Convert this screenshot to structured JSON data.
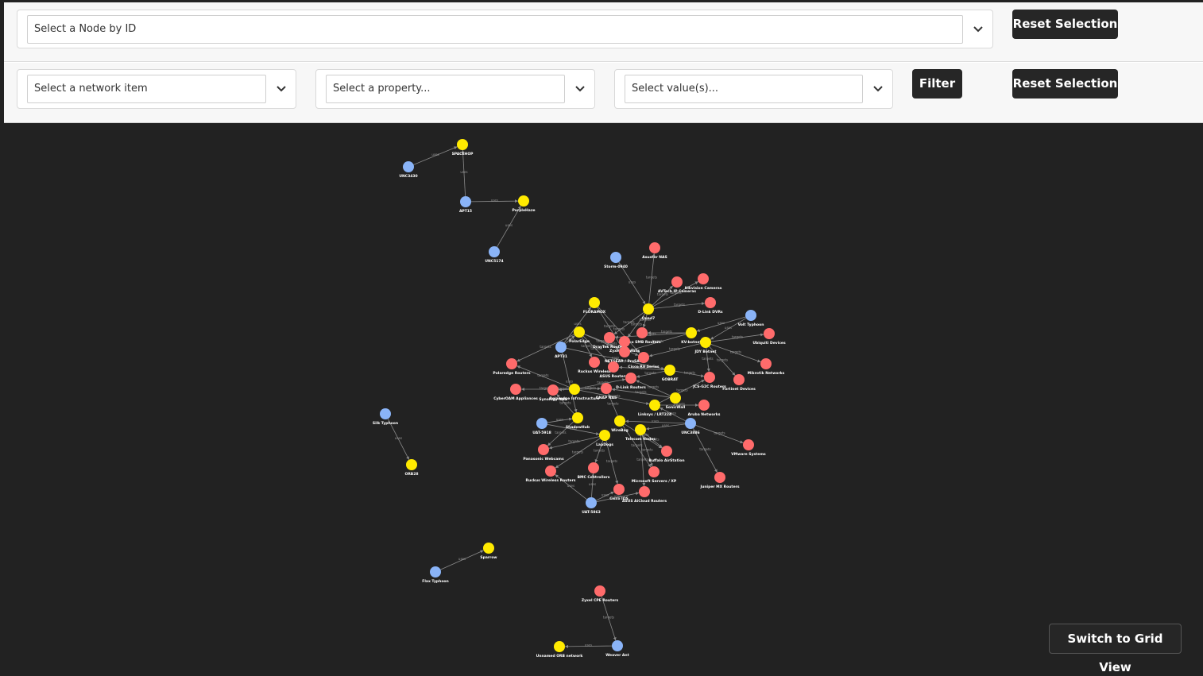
{
  "node_select": {
    "placeholder": "Select a Node by ID",
    "reset_label": "Reset Selection"
  },
  "filter_bar": {
    "network_item_placeholder": "Select a network item",
    "property_placeholder": "Select a property...",
    "value_placeholder": "Select value(s)...",
    "filter_label": "Filter",
    "reset_label": "Reset Selection"
  },
  "graph": {
    "edge_label_targets": "targets",
    "edge_label_uses": "uses",
    "colors": {
      "blue": "#8ab4f8",
      "yellow": "#ffea00",
      "red": "#ff6b6b",
      "background": "#222222",
      "edge": "#8a8a8a",
      "label": "#ffffff"
    },
    "nodes": [
      {
        "id": "unc3430",
        "label": "UNC3430",
        "color": "blue"
      },
      {
        "id": "spacehop",
        "label": "SPACEHOP",
        "color": "yellow"
      },
      {
        "id": "apt15",
        "label": "APT15",
        "color": "blue"
      },
      {
        "id": "purplehaze",
        "label": "PurpleHaze",
        "color": "yellow"
      },
      {
        "id": "unc5174",
        "label": "UNC5174",
        "color": "blue"
      },
      {
        "id": "storm0940",
        "label": "Storm-0940",
        "color": "blue"
      },
      {
        "id": "asustornas",
        "label": "Asustor NAS",
        "color": "red"
      },
      {
        "id": "avtechcam",
        "label": "AVTech IP Cameras",
        "color": "red"
      },
      {
        "id": "hikvision",
        "label": "Hikvision Cameras",
        "color": "red"
      },
      {
        "id": "quad7",
        "label": "Quad7",
        "color": "yellow"
      },
      {
        "id": "floramox",
        "label": "FLORAMOX",
        "color": "yellow"
      },
      {
        "id": "dlinkdvr",
        "label": "D-Link DVRs",
        "color": "red"
      },
      {
        "id": "volttyphoon",
        "label": "Volt Typhoon",
        "color": "blue"
      },
      {
        "id": "ubiquiti",
        "label": "Ubiquiti Devices",
        "color": "red"
      },
      {
        "id": "mikrotik",
        "label": "Mikrotik Networks",
        "color": "red"
      },
      {
        "id": "kvbotnet",
        "label": "KV-botnet",
        "color": "yellow"
      },
      {
        "id": "jdysched",
        "label": "JDY Botnet",
        "color": "yellow"
      },
      {
        "id": "fortinet",
        "label": "Fortinet Devices",
        "color": "red"
      },
      {
        "id": "ciscosmb",
        "label": "Cisco SMB Routers",
        "color": "red"
      },
      {
        "id": "draytek",
        "label": "DrayTek Routers",
        "color": "red"
      },
      {
        "id": "polardsn",
        "label": "PolarEdge",
        "color": "yellow"
      },
      {
        "id": "zyxel",
        "label": "Zyxel Firewalls",
        "color": "red"
      },
      {
        "id": "apt31",
        "label": "APT31",
        "color": "blue"
      },
      {
        "id": "netgear",
        "label": "NETGEAR / ProSAFE",
        "color": "red"
      },
      {
        "id": "ciscorv",
        "label": "Cisco RV Series",
        "color": "red"
      },
      {
        "id": "ruckus",
        "label": "Ruckus Wireless",
        "color": "red"
      },
      {
        "id": "asusrouters",
        "label": "ASUS Routers",
        "color": "red"
      },
      {
        "id": "polaredgerouters",
        "label": "Polaredge Routers",
        "color": "red"
      },
      {
        "id": "gobrat",
        "label": "GOBRAT",
        "color": "yellow"
      },
      {
        "id": "jcsrouters",
        "label": "JCS-G2C Routers",
        "color": "red"
      },
      {
        "id": "dlinkrouters",
        "label": "D-Link Routers",
        "color": "red"
      },
      {
        "id": "cyberoam",
        "label": "CyberOAM Appliances",
        "color": "red"
      },
      {
        "id": "synology",
        "label": "Synology NAS",
        "color": "red"
      },
      {
        "id": "polinfra",
        "label": "Polaredge Infrastructure",
        "color": "yellow"
      },
      {
        "id": "qnapnas",
        "label": "QNAP NAS",
        "color": "red"
      },
      {
        "id": "linksys",
        "label": "Linksys / LRT224",
        "color": "yellow"
      },
      {
        "id": "arubanet",
        "label": "Aruba Networks",
        "color": "red"
      },
      {
        "id": "sonicwall",
        "label": "SonicWall",
        "color": "yellow"
      },
      {
        "id": "uat5918",
        "label": "UAT-5918",
        "color": "blue"
      },
      {
        "id": "shadowhub",
        "label": "ShadowHub",
        "color": "yellow"
      },
      {
        "id": "unc3886",
        "label": "UNC3886",
        "color": "blue"
      },
      {
        "id": "wirebag",
        "label": "WireBag",
        "color": "yellow"
      },
      {
        "id": "lapdogs",
        "label": "LapDogs",
        "color": "yellow"
      },
      {
        "id": "topolnodes",
        "label": "Telecom Nodes",
        "color": "yellow"
      },
      {
        "id": "vmware",
        "label": "VMware Systems",
        "color": "red"
      },
      {
        "id": "panasonic",
        "label": "Panasonic Webcams",
        "color": "red"
      },
      {
        "id": "buffalo",
        "label": "Buffalo AirStation",
        "color": "red"
      },
      {
        "id": "ruckusrouters",
        "label": "Ruckus Wireless Routers",
        "color": "red"
      },
      {
        "id": "bmc",
        "label": "BMC Controllers",
        "color": "red"
      },
      {
        "id": "microsoft",
        "label": "Microsoft Servers / XP",
        "color": "red"
      },
      {
        "id": "junipermx",
        "label": "Juniper MX Routers",
        "color": "red"
      },
      {
        "id": "ciscoios",
        "label": "Cisco IOS",
        "color": "red"
      },
      {
        "id": "asusaicloud",
        "label": "ASUS AiCloud Routers",
        "color": "red"
      },
      {
        "id": "uat5863",
        "label": "UAT-5863",
        "color": "blue"
      },
      {
        "id": "silktyphoon",
        "label": "Silk Typhoon",
        "color": "blue"
      },
      {
        "id": "orb28",
        "label": "ORB28",
        "color": "yellow"
      },
      {
        "id": "sparrow",
        "label": "Sparrow",
        "color": "yellow"
      },
      {
        "id": "flaxtyphoon",
        "label": "Flax Typhoon",
        "color": "blue"
      },
      {
        "id": "zyxelcpe",
        "label": "Zyxel CPE Routers",
        "color": "red"
      },
      {
        "id": "weaverant",
        "label": "Weaver Ant",
        "color": "blue"
      },
      {
        "id": "orbnetwork",
        "label": "Unnamed ORB network",
        "color": "yellow"
      }
    ],
    "edges": [
      [
        "unc3430",
        "spacehop",
        "uses"
      ],
      [
        "apt15",
        "spacehop",
        "uses"
      ],
      [
        "apt15",
        "purplehaze",
        "uses"
      ],
      [
        "unc5174",
        "purplehaze",
        "uses"
      ],
      [
        "storm0940",
        "quad7",
        "uses"
      ],
      [
        "quad7",
        "asustornas",
        "targets"
      ],
      [
        "quad7",
        "avtechcam",
        "targets"
      ],
      [
        "quad7",
        "hikvision",
        "targets"
      ],
      [
        "quad7",
        "dlinkdvr",
        "targets"
      ],
      [
        "quad7",
        "ciscosmb",
        "targets"
      ],
      [
        "quad7",
        "draytek",
        "targets"
      ],
      [
        "quad7",
        "zyxel",
        "targets"
      ],
      [
        "floramox",
        "netgear",
        "targets"
      ],
      [
        "floramox",
        "ciscorv",
        "targets"
      ],
      [
        "apt31",
        "floramox",
        "uses"
      ],
      [
        "apt31",
        "polardsn",
        "uses"
      ],
      [
        "apt31",
        "shadowhub",
        "uses"
      ],
      [
        "apt31",
        "gobrat",
        "uses"
      ],
      [
        "volttyphoon",
        "kvbotnet",
        "uses"
      ],
      [
        "volttyphoon",
        "jdysched",
        "uses"
      ],
      [
        "kvbotnet",
        "ciscosmb",
        "targets"
      ],
      [
        "kvbotnet",
        "netgear",
        "targets"
      ],
      [
        "kvbotnet",
        "draytek",
        "targets"
      ],
      [
        "jdysched",
        "ubiquiti",
        "targets"
      ],
      [
        "jdysched",
        "mikrotik",
        "targets"
      ],
      [
        "jdysched",
        "fortinet",
        "targets"
      ],
      [
        "jdysched",
        "jcsrouters",
        "targets"
      ],
      [
        "jdysched",
        "ciscorv",
        "targets"
      ],
      [
        "polardsn",
        "ciscorv",
        "targets"
      ],
      [
        "polardsn",
        "asusrouters",
        "targets"
      ],
      [
        "polardsn",
        "ruckus",
        "targets"
      ],
      [
        "polardsn",
        "netgear",
        "targets"
      ],
      [
        "polardsn",
        "polaredgerouters",
        "targets"
      ],
      [
        "polinfra",
        "synology",
        "targets"
      ],
      [
        "polinfra",
        "qnapnas",
        "targets"
      ],
      [
        "polinfra",
        "dlinkrouters",
        "targets"
      ],
      [
        "polinfra",
        "cyberoam",
        "targets"
      ],
      [
        "polinfra",
        "polaredgerouters",
        "targets"
      ],
      [
        "gobrat",
        "asusrouters",
        "targets"
      ],
      [
        "gobrat",
        "dlinkrouters",
        "targets"
      ],
      [
        "linksys",
        "arubanet",
        "targets"
      ],
      [
        "linksys",
        "jcsrouters",
        "targets"
      ],
      [
        "sonicwall",
        "qnapnas",
        "targets"
      ],
      [
        "sonicwall",
        "dlinkrouters",
        "targets"
      ],
      [
        "uat5918",
        "shadowhub",
        "uses"
      ],
      [
        "uat5918",
        "lapdogs",
        "uses"
      ],
      [
        "shadowhub",
        "synology",
        "targets"
      ],
      [
        "shadowhub",
        "panasonic",
        "targets"
      ],
      [
        "unc3886",
        "wirebag",
        "uses"
      ],
      [
        "unc3886",
        "topolnodes",
        "uses"
      ],
      [
        "unc3886",
        "linksys",
        "uses"
      ],
      [
        "unc3886",
        "vmware",
        "targets"
      ],
      [
        "unc3886",
        "junipermx",
        "targets"
      ],
      [
        "wirebag",
        "buffalo",
        "targets"
      ],
      [
        "wirebag",
        "microsoft",
        "targets"
      ],
      [
        "wirebag",
        "qnapnas",
        "targets"
      ],
      [
        "lapdogs",
        "ruckusrouters",
        "targets"
      ],
      [
        "lapdogs",
        "bmc",
        "targets"
      ],
      [
        "lapdogs",
        "panasonic",
        "targets"
      ],
      [
        "lapdogs",
        "ciscoios",
        "targets"
      ],
      [
        "topolnodes",
        "asusaicloud",
        "targets"
      ],
      [
        "topolnodes",
        "microsoft",
        "targets"
      ],
      [
        "uat5863",
        "ciscoios",
        "uses"
      ],
      [
        "uat5863",
        "asusaicloud",
        "uses"
      ],
      [
        "uat5863",
        "ruckusrouters",
        "uses"
      ],
      [
        "uat5863",
        "bmc",
        "uses"
      ],
      [
        "topolnodes",
        "buffalo",
        "targets"
      ],
      [
        "polinfra",
        "linksys",
        "targets"
      ],
      [
        "gobrat",
        "jcsrouters",
        "targets"
      ],
      [
        "silktyphoon",
        "orb28",
        "uses"
      ],
      [
        "flaxtyphoon",
        "sparrow",
        "uses"
      ],
      [
        "zyxelcpe",
        "weaverant",
        "targets"
      ],
      [
        "weaverant",
        "orbnetwork",
        "uses"
      ]
    ]
  },
  "view_toggle": {
    "label": "Switch to Grid View"
  }
}
